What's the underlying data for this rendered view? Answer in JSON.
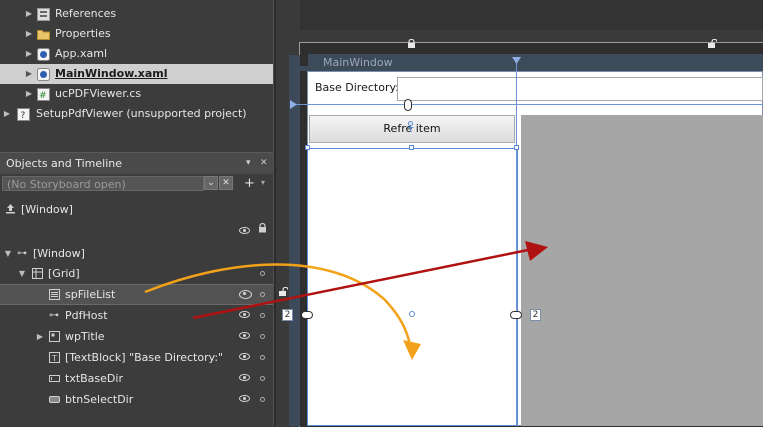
{
  "solution_tree": [
    {
      "label": "References",
      "icon": "references-icon",
      "indent": 1,
      "has_arrow": true,
      "selected": false
    },
    {
      "label": "Properties",
      "icon": "folder-icon",
      "indent": 1,
      "has_arrow": true,
      "selected": false
    },
    {
      "label": "App.xaml",
      "icon": "xaml-file-icon",
      "indent": 1,
      "has_arrow": true,
      "selected": false
    },
    {
      "label": "MainWindow.xaml",
      "icon": "xaml-file-icon",
      "indent": 1,
      "has_arrow": true,
      "selected": true
    },
    {
      "label": "ucPDFViewer.cs",
      "icon": "csharp-file-icon",
      "indent": 1,
      "has_arrow": true,
      "selected": false
    },
    {
      "label": "SetupPdfViewer (unsupported project)",
      "icon": "unsupported-project-icon",
      "indent": 0,
      "has_arrow": true,
      "selected": false
    }
  ],
  "objects_panel": {
    "title": "Objects and Timeline",
    "storyboard": "(No Storyboard open)",
    "scope": "[Window]",
    "tree": [
      {
        "label": "[Window]",
        "indent": 0,
        "expanded": true
      },
      {
        "label": "[Grid]",
        "indent": 1,
        "expanded": true
      },
      {
        "label": "spFileList",
        "indent": 2,
        "selected": true
      },
      {
        "label": "PdfHost",
        "indent": 2
      },
      {
        "label": "wpTitle",
        "indent": 2,
        "collapsed": true
      },
      {
        "label": "[TextBlock] \"Base Directory:\"",
        "indent": 2
      },
      {
        "label": "txtBaseDir",
        "indent": 2
      },
      {
        "label": "btnSelectDir",
        "indent": 2
      }
    ]
  },
  "designer": {
    "window_title": "MainWindow",
    "base_directory_label": "Base Directory:",
    "refresh_button": "Refre   item",
    "margin_left": "2",
    "margin_right": "2"
  },
  "colors": {
    "arrow_orange": "#f2a21a",
    "arrow_red": "#b01111",
    "selection_blue": "#5b8bd0",
    "pdf_host_gray": "#a6a6a6"
  }
}
